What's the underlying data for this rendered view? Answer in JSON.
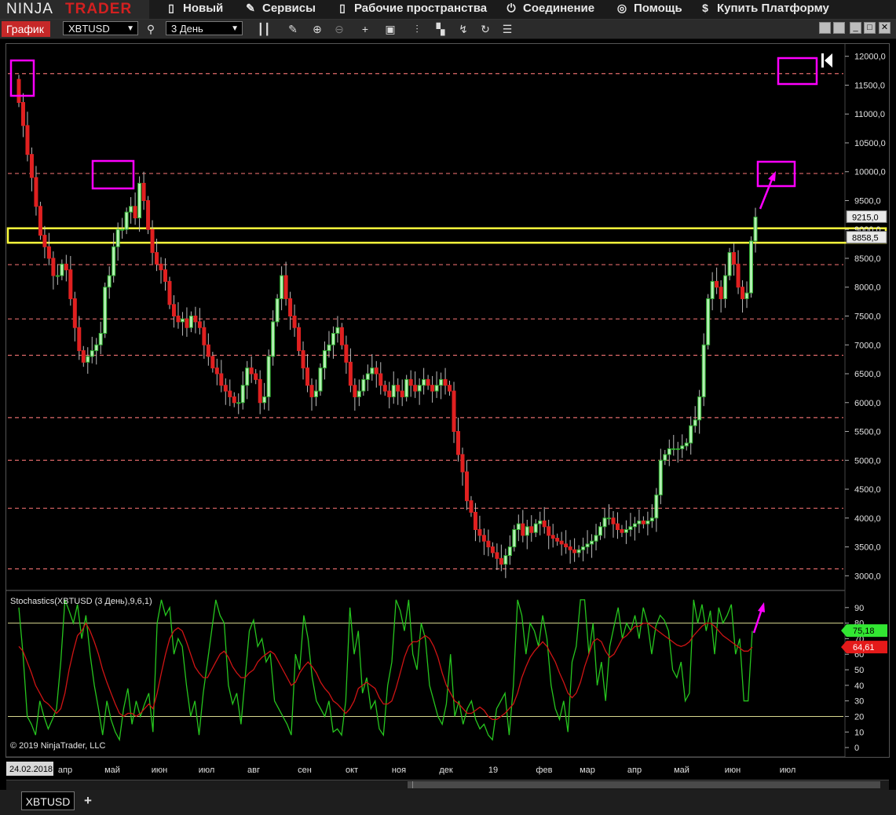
{
  "app": {
    "brand_ninja": "NINJA",
    "brand_trader": "TRADER"
  },
  "menu": [
    {
      "label": "Новый",
      "icon": "new-document-icon"
    },
    {
      "label": "Сервисы",
      "icon": "wrench-icon"
    },
    {
      "label": "Рабочие пространства",
      "icon": "workspace-document-icon"
    },
    {
      "label": "Соединение",
      "icon": "plug-icon"
    },
    {
      "label": "Помощь",
      "icon": "help-lifebuoy-icon"
    },
    {
      "label": "Купить Платформу",
      "icon": "dollar-icon"
    }
  ],
  "toolbar": {
    "tab_label": "График",
    "instrument": "XBTUSD",
    "period": "3 День",
    "icons": [
      "search-icon",
      "bar-style-icon",
      "pencil-draw-icon",
      "zoom-in-icon",
      "zoom-out-icon",
      "crosshair-icon",
      "data-box-icon",
      "indicators-icon",
      "strategies-icon",
      "drawing-tools-icon",
      "reload-icon",
      "properties-list-icon"
    ]
  },
  "colors": {
    "up": "#2fae2f",
    "down": "#e02020",
    "up_fill": "#b3f0b3",
    "level": "#e06a6a",
    "highlight_box": "#ff00ff",
    "highlight_zone": "#ffff3c",
    "stoch_k": "#26c51e",
    "stoch_d": "#cf1414",
    "stoch_line": "#d8d890"
  },
  "chart_data": [
    {
      "type": "candlestick",
      "title": "",
      "ylim": [
        2800,
        12200
      ],
      "y_ticks": [
        "12000,0",
        "11500,0",
        "11000,0",
        "10500,0",
        "10000,0",
        "9500,0",
        "9000,0",
        "8500,0",
        "8000,0",
        "7500,0",
        "7000,0",
        "6500,0",
        "6000,0",
        "5500,0",
        "5000,0",
        "4500,0",
        "4000,0",
        "3500,0",
        "3000,0"
      ],
      "y_tick_values": [
        12000,
        11500,
        11000,
        10500,
        10000,
        9500,
        9000,
        8500,
        8000,
        7500,
        7000,
        6500,
        6000,
        5500,
        5000,
        4500,
        4000,
        3500,
        3000
      ],
      "price_labels": [
        {
          "text": "9215,0",
          "value": 9215
        },
        {
          "text": "8858,5",
          "value": 8858.5
        }
      ],
      "horizontal_levels": [
        11700,
        9970,
        8390,
        7450,
        6820,
        5740,
        5000,
        4170,
        3120
      ],
      "yellow_zone": [
        8770,
        9020
      ],
      "closes": [
        11200,
        10800,
        10300,
        9900,
        9400,
        8900,
        8700,
        8500,
        8200,
        8200,
        8400,
        8300,
        7800,
        7300,
        6900,
        6700,
        6800,
        6900,
        7000,
        7200,
        8000,
        8200,
        8700,
        9000,
        9000,
        9300,
        9400,
        9200,
        9800,
        9500,
        9000,
        8600,
        8400,
        8300,
        8100,
        7700,
        7500,
        7400,
        7450,
        7300,
        7500,
        7400,
        7300,
        7000,
        6800,
        6600,
        6500,
        6300,
        6200,
        6100,
        6000,
        6000,
        6300,
        6600,
        6500,
        6400,
        6000,
        6100,
        6800,
        7400,
        7800,
        8200,
        7800,
        7500,
        7300,
        6900,
        6600,
        6300,
        6100,
        6200,
        6600,
        6900,
        7000,
        7200,
        7300,
        7000,
        6700,
        6300,
        6100,
        6200,
        6400,
        6500,
        6600,
        6500,
        6300,
        6200,
        6100,
        6300,
        6200,
        6100,
        6400,
        6300,
        6200,
        6300,
        6400,
        6300,
        6200,
        6300,
        6400,
        6300,
        6200,
        5500,
        5100,
        4800,
        4300,
        4100,
        3800,
        3700,
        3600,
        3500,
        3400,
        3300,
        3200,
        3350,
        3500,
        3800,
        3900,
        3700,
        3850,
        3750,
        3900,
        3950,
        3850,
        3700,
        3650,
        3600,
        3550,
        3500,
        3450,
        3400,
        3450,
        3500,
        3550,
        3600,
        3700,
        3850,
        4000,
        4000,
        3900,
        3800,
        3750,
        3800,
        3850,
        3900,
        3950,
        3900,
        3950,
        4000,
        4400,
        5000,
        5100,
        5200,
        5200,
        5200,
        5250,
        5300,
        5600,
        5700,
        6100,
        7000,
        7800,
        8100,
        8000,
        7800,
        8200,
        8600,
        8400,
        8000,
        7800,
        7900,
        8800,
        9215
      ],
      "x_labels": [
        {
          "text": "24.02.2018",
          "x": 38
        },
        {
          "text": "апр",
          "x": 83
        },
        {
          "text": "май",
          "x": 143
        },
        {
          "text": "июн",
          "x": 203
        },
        {
          "text": "июл",
          "x": 263
        },
        {
          "text": "авг",
          "x": 323
        },
        {
          "text": "сен",
          "x": 388
        },
        {
          "text": "окт",
          "x": 448
        },
        {
          "text": "ноя",
          "x": 508
        },
        {
          "text": "дек",
          "x": 568
        },
        {
          "text": "19",
          "x": 628
        },
        {
          "text": "фев",
          "x": 693
        },
        {
          "text": "мар",
          "x": 748
        },
        {
          "text": "апр",
          "x": 808
        },
        {
          "text": "май",
          "x": 868
        },
        {
          "text": "июн",
          "x": 933
        },
        {
          "text": "июл",
          "x": 1003
        }
      ]
    },
    {
      "type": "line",
      "title": "Stochastics(XBTUSD (3 День),9,6,1)",
      "ylim": [
        -5,
        100
      ],
      "y_ticks": [
        "90",
        "80",
        "70",
        "60",
        "50",
        "40",
        "30",
        "20",
        "10",
        "0"
      ],
      "y_tick_values": [
        90,
        80,
        70,
        60,
        50,
        40,
        30,
        20,
        10,
        0
      ],
      "reference_lines": [
        80,
        20
      ],
      "value_labels": [
        {
          "text": "75,18",
          "value": 75.18,
          "series": "K"
        },
        {
          "text": "64,61",
          "value": 64.61,
          "series": "D"
        }
      ],
      "series": [
        {
          "values": [
            90,
            60,
            20,
            15,
            8,
            30,
            20,
            12,
            18,
            25,
            55,
            95,
            88,
            80,
            92,
            70,
            85,
            60,
            40,
            25,
            8,
            30,
            18,
            10,
            5,
            25,
            38,
            15,
            30,
            20,
            28,
            35,
            10,
            80,
            95,
            85,
            90,
            60,
            70,
            65,
            40,
            20,
            30,
            8,
            35,
            55,
            75,
            95,
            85,
            80,
            40,
            28,
            35,
            15,
            45,
            75,
            82,
            65,
            70,
            55,
            60,
            30,
            25,
            20,
            15,
            8,
            60,
            50,
            85,
            70,
            45,
            30,
            25,
            20,
            30,
            10,
            12,
            8,
            30,
            90,
            60,
            75,
            35,
            45,
            25,
            30,
            12,
            8,
            40,
            55,
            95,
            88,
            75,
            95,
            60,
            50,
            80,
            70,
            40,
            30,
            20,
            15,
            28,
            60,
            20,
            30,
            15,
            25,
            30,
            18,
            12,
            15,
            8,
            5,
            25,
            30,
            35,
            8,
            40,
            95,
            85,
            60,
            80,
            75,
            65,
            85,
            70,
            40,
            25,
            18,
            30,
            10,
            55,
            65,
            95,
            95,
            60,
            80,
            40,
            55,
            30,
            65,
            78,
            90,
            70,
            80,
            75,
            85,
            70,
            90,
            80,
            60,
            78,
            85,
            82,
            75,
            50,
            45,
            55,
            30,
            35,
            95,
            80,
            92,
            75,
            88,
            60,
            90,
            80,
            85,
            92,
            60,
            70,
            30,
            30,
            75
          ]
        },
        {
          "values": [
            65,
            62,
            55,
            48,
            40,
            35,
            30,
            28,
            25,
            22,
            25,
            35,
            50,
            62,
            72,
            75,
            80,
            75,
            68,
            60,
            50,
            42,
            35,
            28,
            22,
            20,
            22,
            22,
            20,
            22,
            25,
            28,
            25,
            35,
            48,
            60,
            70,
            75,
            77,
            75,
            68,
            60,
            52,
            48,
            45,
            45,
            50,
            55,
            60,
            62,
            58,
            52,
            48,
            45,
            45,
            48,
            50,
            55,
            58,
            60,
            62,
            60,
            55,
            50,
            45,
            40,
            42,
            48,
            52,
            55,
            52,
            48,
            42,
            38,
            35,
            30,
            28,
            25,
            22,
            25,
            30,
            38,
            40,
            42,
            40,
            38,
            32,
            28,
            28,
            30,
            38,
            48,
            58,
            65,
            68,
            68,
            70,
            72,
            70,
            65,
            58,
            48,
            40,
            35,
            30,
            28,
            25,
            22,
            22,
            24,
            26,
            24,
            20,
            18,
            18,
            20,
            22,
            25,
            28,
            35,
            45,
            52,
            58,
            62,
            65,
            68,
            65,
            60,
            55,
            48,
            42,
            35,
            32,
            35,
            42,
            52,
            60,
            68,
            70,
            68,
            62,
            58,
            60,
            65,
            70,
            72,
            75,
            78,
            78,
            80,
            80,
            78,
            76,
            74,
            72,
            70,
            68,
            66,
            65,
            66,
            68,
            72,
            75,
            78,
            80,
            80,
            78,
            75,
            72,
            70,
            68,
            66,
            64,
            62,
            62,
            64.61
          ]
        }
      ]
    }
  ],
  "annotations": {
    "copyright": "© 2019 NinjaTrader, LLC"
  },
  "bottom_tabs": {
    "active": "XBTUSD",
    "add": "+"
  }
}
